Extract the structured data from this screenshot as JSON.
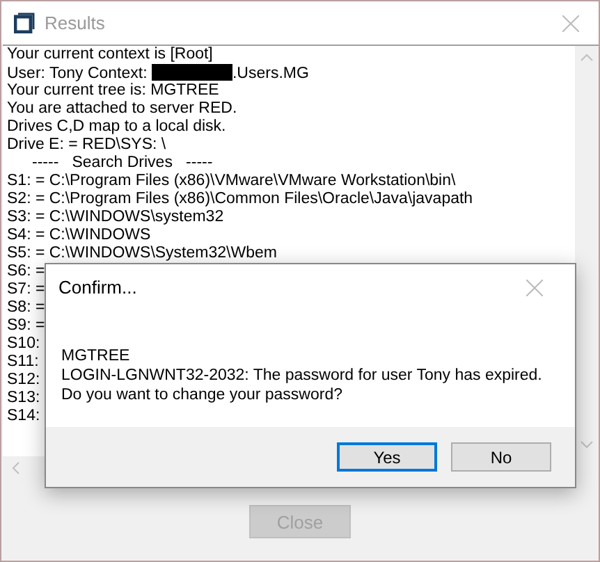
{
  "window": {
    "title": "Results",
    "close_button": {
      "disabled": true,
      "label": "Close"
    }
  },
  "output_lines": [
    {
      "kind": "text",
      "text": "Your current context is [Root]"
    },
    {
      "kind": "redacted",
      "before": "User: Tony Context: ",
      "after": ".Users.MG"
    },
    {
      "kind": "text",
      "text": "Your current tree is: MGTREE"
    },
    {
      "kind": "text",
      "text": "You are attached to server RED."
    },
    {
      "kind": "text",
      "text": "Drives C,D map to a local disk."
    },
    {
      "kind": "text",
      "text": "Drive E: = RED\\SYS: \\"
    },
    {
      "kind": "heading",
      "text": "-----   Search Drives   -----"
    },
    {
      "kind": "text",
      "text": "S1: = C:\\Program Files (x86)\\VMware\\VMware Workstation\\bin\\"
    },
    {
      "kind": "text",
      "text": "S2: = C:\\Program Files (x86)\\Common Files\\Oracle\\Java\\javapath"
    },
    {
      "kind": "text",
      "text": "S3: = C:\\WINDOWS\\system32"
    },
    {
      "kind": "text",
      "text": "S4: = C:\\WINDOWS"
    },
    {
      "kind": "text",
      "text": "S5: = C:\\WINDOWS\\System32\\Wbem"
    },
    {
      "kind": "text",
      "text": "S6: ="
    },
    {
      "kind": "text",
      "text": "S7: ="
    },
    {
      "kind": "text",
      "text": "S8: ="
    },
    {
      "kind": "text",
      "text": "S9: ="
    },
    {
      "kind": "text",
      "text": "S10:"
    },
    {
      "kind": "text",
      "text": "S11:"
    },
    {
      "kind": "text",
      "text": "S12:"
    },
    {
      "kind": "text",
      "text": "S13:"
    },
    {
      "kind": "text",
      "text": "S14:"
    }
  ],
  "dialog": {
    "title": "Confirm...",
    "message": [
      "MGTREE",
      "LOGIN-LGNWNT32-2032: The password for user Tony has expired.",
      "Do you want to change your password?"
    ],
    "buttons": [
      {
        "label": "Yes",
        "selected": true
      },
      {
        "label": "No",
        "selected": false
      }
    ]
  }
}
